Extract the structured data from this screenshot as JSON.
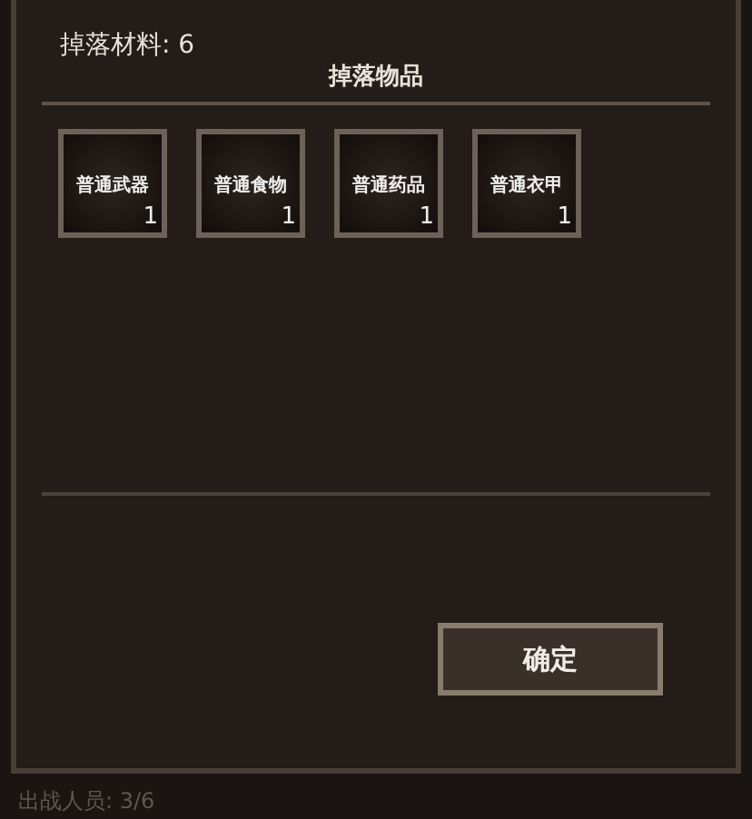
{
  "drop_materials": "掉落材料: 6",
  "drop_items_title": "掉落物品",
  "items": [
    {
      "name": "普通武器",
      "count": "1"
    },
    {
      "name": "普通食物",
      "count": "1"
    },
    {
      "name": "普通药品",
      "count": "1"
    },
    {
      "name": "普通衣甲",
      "count": "1"
    }
  ],
  "confirm_button": "确定",
  "status_bar": "出战人员: 3/6"
}
